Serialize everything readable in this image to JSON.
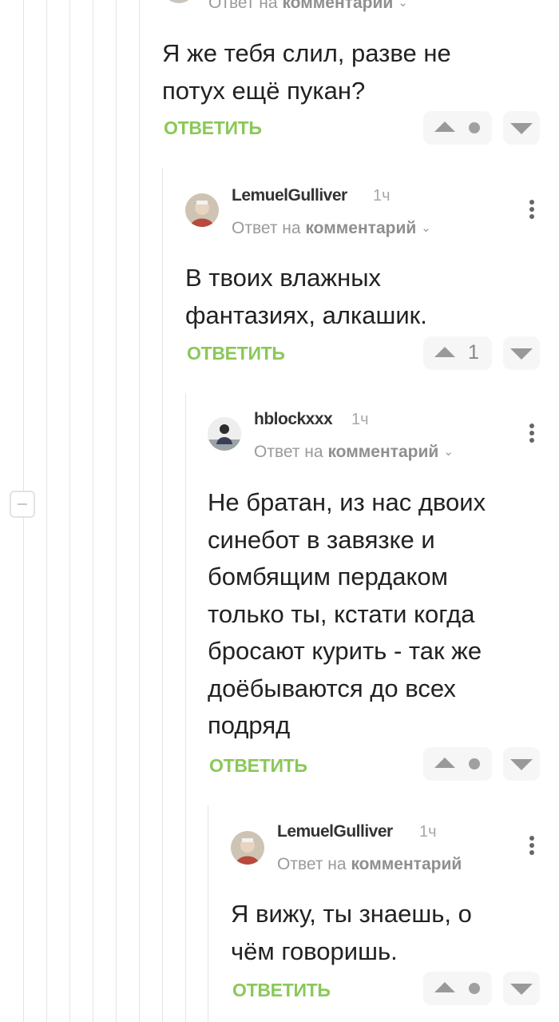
{
  "colors": {
    "reply_button": "#8ac858",
    "thread_line": "#e4e4e4"
  },
  "top": {
    "reply_to_prefix": "Ответ на",
    "reply_to_link": "комментарий",
    "body": "Я же тебя слил, разве не потух ещё пукан?",
    "reply_label": "ОТВЕТИТЬ",
    "score": ""
  },
  "comments": [
    {
      "author": "LemuelGulliver",
      "time": "1ч",
      "reply_to_prefix": "Ответ на",
      "reply_to_link": "комментарий",
      "body": "В твоих влажных фантазиях, алкашик.",
      "reply_label": "ОТВЕТИТЬ",
      "score": "1"
    },
    {
      "author": "hblockxxx",
      "time": "1ч",
      "reply_to_prefix": "Ответ на",
      "reply_to_link": "комментарий",
      "body": "Не братан, из нас двоих синебот в завязке и бомбящим пердаком только ты, кстати когда бросают курить - так же доёбываются до всех подряд",
      "reply_label": "ОТВЕТИТЬ",
      "score": ""
    },
    {
      "author": "LemuelGulliver",
      "time": "1ч",
      "reply_to_prefix": "Ответ на",
      "reply_to_link": "комментарий",
      "body": "Я вижу, ты знаешь, о чём говоришь.",
      "reply_label": "ОТВЕТИТЬ",
      "score": ""
    }
  ]
}
